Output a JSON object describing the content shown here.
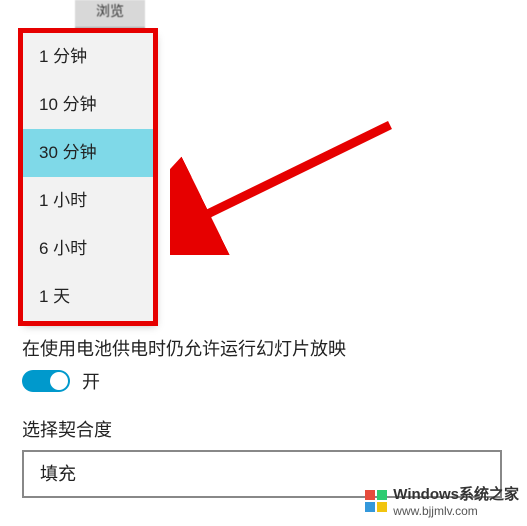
{
  "top_button": "浏览",
  "dropdown": {
    "options": [
      "1 分钟",
      "10 分钟",
      "30 分钟",
      "1 小时",
      "6 小时",
      "1 天"
    ],
    "selected_index": 2
  },
  "battery_slideshow_label": "在使用电池供电时仍允许运行幻灯片放映",
  "toggle": {
    "state_label": "开",
    "on": true
  },
  "fit_section_label": "选择契合度",
  "fit_select_value": "填充",
  "watermark": {
    "title": "Windows系统之家",
    "url": "www.bjjmlv.com"
  }
}
